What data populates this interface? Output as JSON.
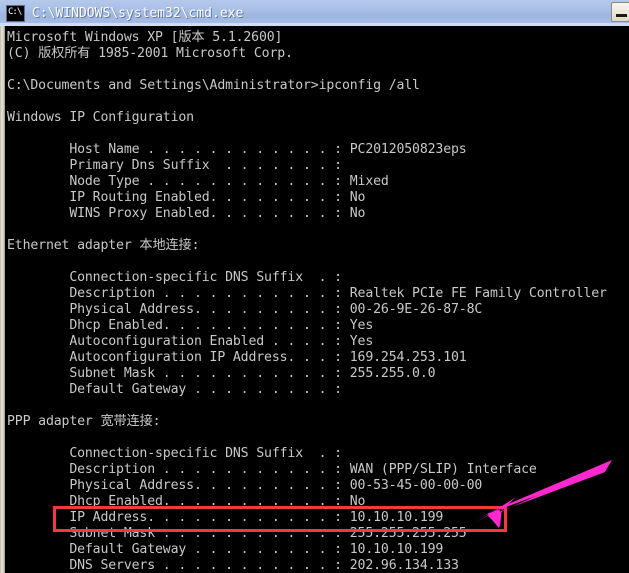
{
  "window": {
    "title": "C:\\WINDOWS\\system32\\cmd.exe",
    "icon_label": "C:\\",
    "icon_name": "cmd-console-icon",
    "minimize_label": "",
    "titlebar_color": "#9cb5e0",
    "background_color": "#000000",
    "text_color": "#c8c8c8"
  },
  "console": {
    "lines": [
      "Microsoft Windows XP [版本 5.1.2600]",
      "(C) 版权所有 1985-2001 Microsoft Corp.",
      "",
      "C:\\Documents and Settings\\Administrator>ipconfig /all",
      "",
      "Windows IP Configuration",
      "",
      "        Host Name . . . . . . . . . . . . : PC2012050823eps",
      "        Primary Dns Suffix  . . . . . . . :",
      "        Node Type . . . . . . . . . . . . : Mixed",
      "        IP Routing Enabled. . . . . . . . : No",
      "        WINS Proxy Enabled. . . . . . . . : No",
      "",
      "Ethernet adapter 本地连接:",
      "",
      "        Connection-specific DNS Suffix  . :",
      "        Description . . . . . . . . . . . : Realtek PCIe FE Family Controller",
      "        Physical Address. . . . . . . . . : 00-26-9E-26-87-8C",
      "        Dhcp Enabled. . . . . . . . . . . : Yes",
      "        Autoconfiguration Enabled . . . . : Yes",
      "        Autoconfiguration IP Address. . . : 169.254.253.101",
      "        Subnet Mask . . . . . . . . . . . : 255.255.0.0",
      "        Default Gateway . . . . . . . . . :",
      "",
      "PPP adapter 宽带连接:",
      "",
      "        Connection-specific DNS Suffix  . :",
      "        Description . . . . . . . . . . . : WAN (PPP/SLIP) Interface",
      "        Physical Address. . . . . . . . . : 00-53-45-00-00-00",
      "        Dhcp Enabled. . . . . . . . . . . : No",
      "        IP Address. . . . . . . . . . . . : 10.10.10.199",
      "        Subnet Mask . . . . . . . . . . . : 255.255.255.255",
      "        Default Gateway . . . . . . . . . : 10.10.10.199",
      "        DNS Servers . . . . . . . . . . . : 202.96.134.133"
    ]
  },
  "command": {
    "prompt": "C:\\Documents and Settings\\Administrator>",
    "text": "ipconfig /all"
  },
  "system_info": {
    "os_version": "Microsoft Windows XP [版本 5.1.2600]",
    "copyright": "(C) 版权所有 1985-2001 Microsoft Corp.",
    "host_name": "PC2012050823eps",
    "primary_dns_suffix": "",
    "node_type": "Mixed",
    "ip_routing_enabled": "No",
    "wins_proxy_enabled": "No"
  },
  "adapters": [
    {
      "title": "Ethernet adapter 本地连接:",
      "connection_specific_dns_suffix": "",
      "description": "Realtek PCIe FE Family Controller",
      "physical_address": "00-26-9E-26-87-8C",
      "dhcp_enabled": "Yes",
      "autoconfiguration_enabled": "Yes",
      "autoconfiguration_ip_address": "169.254.253.101",
      "subnet_mask": "255.255.0.0",
      "default_gateway": ""
    },
    {
      "title": "PPP adapter 宽带连接:",
      "connection_specific_dns_suffix": "",
      "description": "WAN (PPP/SLIP) Interface",
      "physical_address": "00-53-45-00-00-00",
      "dhcp_enabled": "No",
      "ip_address": "10.10.10.199",
      "subnet_mask": "255.255.255.255",
      "default_gateway": "10.10.10.199",
      "dns_servers": "202.96.134.133"
    }
  ],
  "annotation": {
    "highlight_color": "#f4393c",
    "arrow_color": "#ff28d0",
    "highlighted_value": "10.10.10.199",
    "highlighted_label": "IP Address"
  }
}
